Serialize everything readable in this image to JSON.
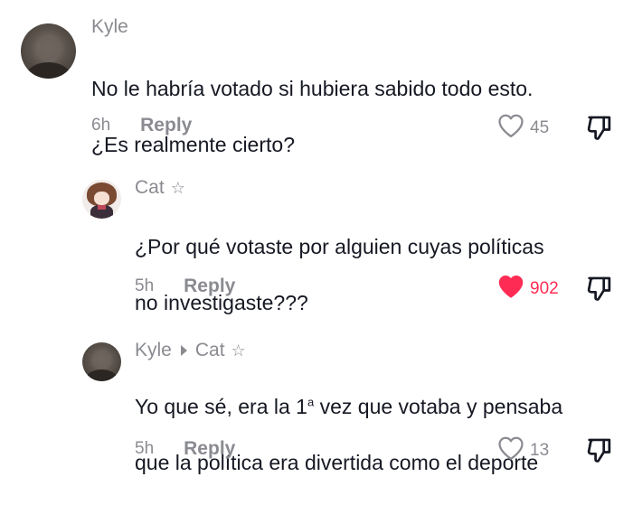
{
  "comments": [
    {
      "username": "Kyle",
      "reply_to": "",
      "badge": "",
      "text_lines": [
        "No le habría votado si hubiera sabido todo esto.",
        "¿Es realmente cierto?"
      ],
      "time": "6h",
      "reply_label": "Reply",
      "likes": "45",
      "liked": false,
      "avatar_icon": "kyle-avatar"
    },
    {
      "username": "Cat",
      "reply_to": "",
      "badge": "☆",
      "text_lines": [
        "¿Por qué votaste por alguien cuyas políticas",
        "no investigaste???"
      ],
      "time": "5h",
      "reply_label": "Reply",
      "likes": "902",
      "liked": true,
      "avatar_icon": "cat-avatar"
    },
    {
      "username": "Kyle",
      "reply_to": "Cat",
      "badge": "☆",
      "text_line1_before": "Yo que sé, era la 1",
      "text_line1_sup": "a",
      "text_line1_after": " vez que votaba y pensaba",
      "text_line2": "que la política era divertida como el deporte",
      "time": "5h",
      "reply_label": "Reply",
      "likes": "13",
      "liked": false,
      "avatar_icon": "kyle-avatar"
    }
  ],
  "colors": {
    "text": "#161823",
    "secondary": "#8a8b91",
    "like_active": "#fe2c55"
  },
  "icons": {
    "like": "heart-icon",
    "like_active": "heart-filled-icon",
    "dislike": "thumbs-down-icon",
    "reply_caret": "caret-right-icon",
    "badge": "star-outline-icon"
  }
}
